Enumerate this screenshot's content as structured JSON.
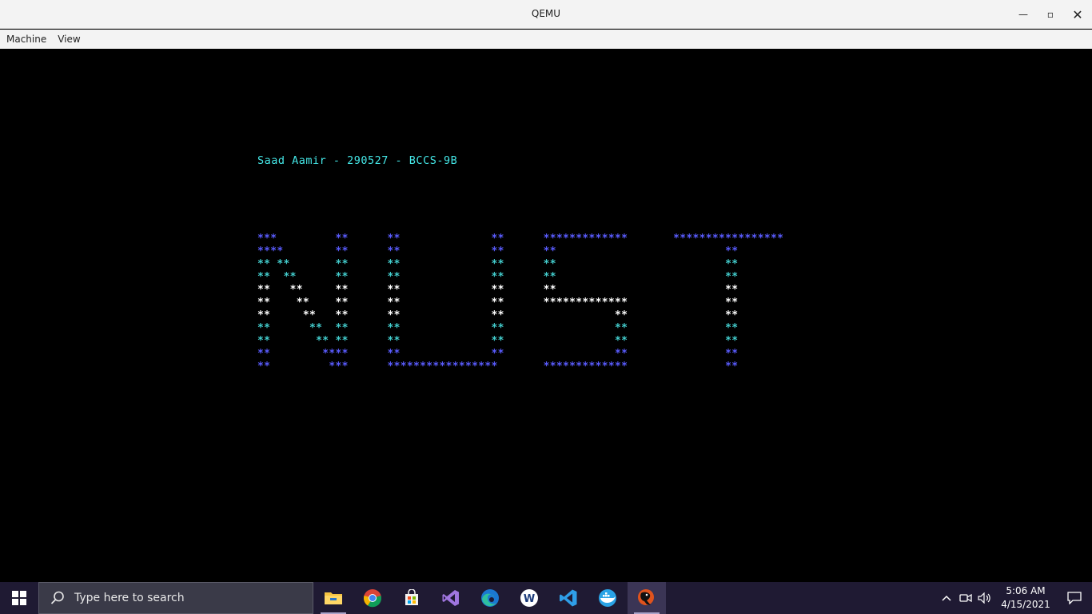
{
  "window": {
    "title": "QEMU",
    "min_glyph": "—",
    "max_glyph": "▫",
    "close_glyph": "✕"
  },
  "menu": [
    "Machine",
    "View"
  ],
  "screen": {
    "header_text": "Saad Aamir - 290527 - BCCS-9B",
    "header_color": "#44e6e6",
    "art_colors": [
      "#5a5cff",
      "#44d0d0",
      "#ffffff"
    ],
    "art_rows": [
      "***         **      **              **      *************       *****************",
      "****        **      **              **      **                          **",
      "** **       **      **              **      **                          **",
      "**  **      **      **              **      **                          **",
      "**   **     **      **              **      **                          **",
      "**    **    **      **              **      *************               **",
      "**     **   **      **              **                 **               **",
      "**      **  **      **              **                 **               **",
      "**       ** **      **              **                 **               **",
      "**        ****      **              **                 **               **",
      "**         ***      *****************       *************               **"
    ]
  },
  "taskbar": {
    "search_placeholder": "Type here to search",
    "apps": [
      {
        "name": "file-explorer-icon",
        "color": "#f5c342"
      },
      {
        "name": "chrome-icon",
        "color": "#4285f4"
      },
      {
        "name": "store-icon",
        "color": "#f2f2f2"
      },
      {
        "name": "visual-studio-icon",
        "color": "#a076e0"
      },
      {
        "name": "edge-icon",
        "color": "#2fbf9f"
      },
      {
        "name": "app-w-icon",
        "color": "#ffffff"
      },
      {
        "name": "vscode-icon",
        "color": "#2f9ee8"
      },
      {
        "name": "docker-icon",
        "color": "#2aa3e6"
      },
      {
        "name": "qemu-icon",
        "color": "#e0531d"
      }
    ],
    "time": "5:06 AM",
    "date": "4/15/2021"
  }
}
